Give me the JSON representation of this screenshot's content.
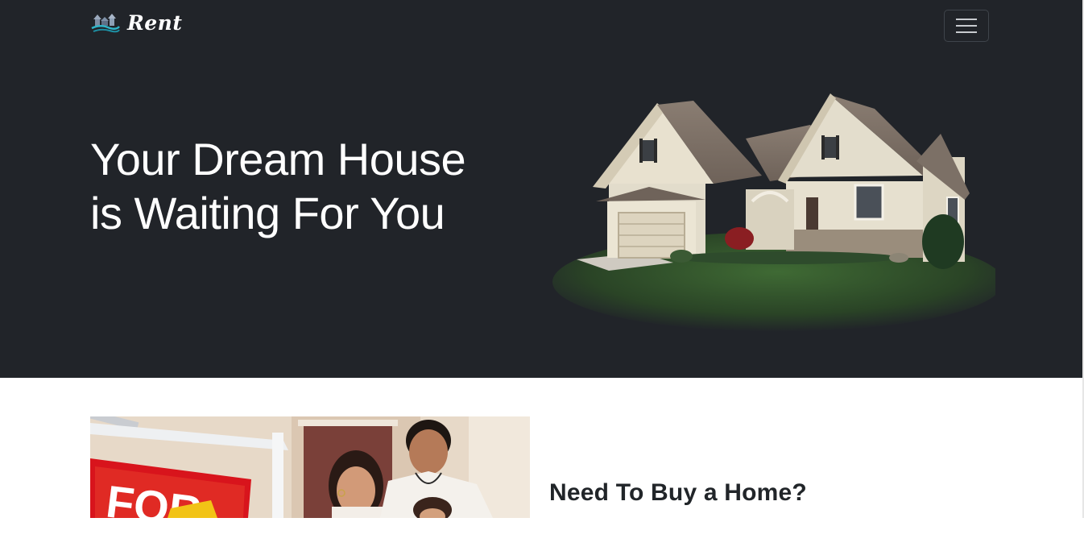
{
  "navbar": {
    "brand_name": "Rent",
    "logo_icon": "house-logo-icon",
    "toggler_icon": "hamburger-menu-icon"
  },
  "hero": {
    "headline": "Your Dream House is Waiting For You",
    "image": "suburban-house-image"
  },
  "feature": {
    "heading": "Need To Buy a Home?",
    "image": "family-for-sale-sign-photo"
  },
  "colors": {
    "hero_background": "#212429",
    "text_light": "#ffffff",
    "text_dark": "#212529",
    "sign_red": "#d8141c"
  }
}
